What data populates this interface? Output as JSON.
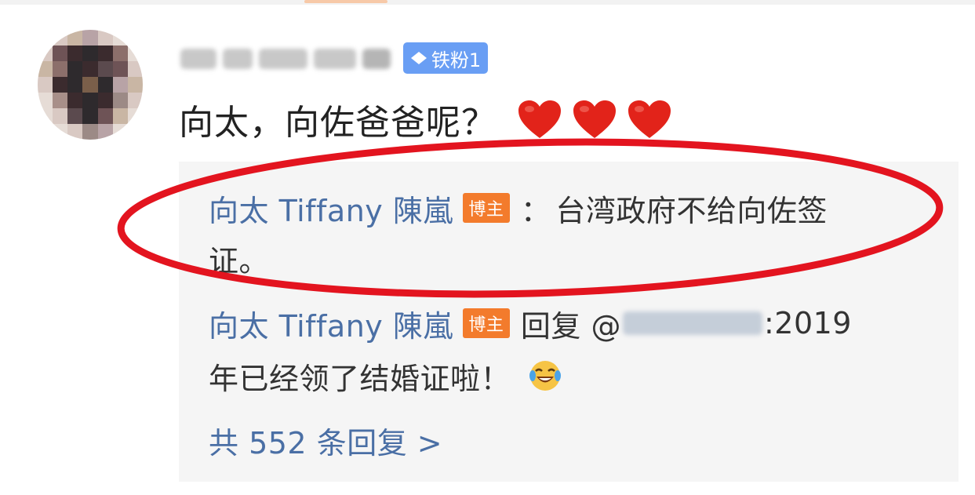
{
  "colors": {
    "accent_link": "#4a6fa5",
    "badge_blue": "#4f8ef3",
    "badge_orange": "#f37b2c",
    "highlight_red": "#e3141f",
    "heart_red": "#e2231a",
    "panel_bg": "#f5f5f5"
  },
  "comment": {
    "avatar_icon": "avatar-icon",
    "fan_badge_label": "铁粉1",
    "text": "向太，向佐爸爸呢？",
    "hearts": [
      "heart-icon",
      "heart-icon",
      "heart-icon"
    ]
  },
  "replies": [
    {
      "author": "向太 Tiffany 陳嵐",
      "badge": "博主",
      "separator": "：",
      "text_line1": "台湾政府不给向佐签",
      "text_line2": "证。"
    },
    {
      "author": "向太 Tiffany 陳嵐",
      "badge": "博主",
      "reply_label": "回复 @",
      "text_tail": ":2019",
      "text_line2": "年已经领了结婚证啦！",
      "emoji": "laughing-crying-emoji-icon"
    }
  ],
  "more_replies": "共 552 条回复 >"
}
